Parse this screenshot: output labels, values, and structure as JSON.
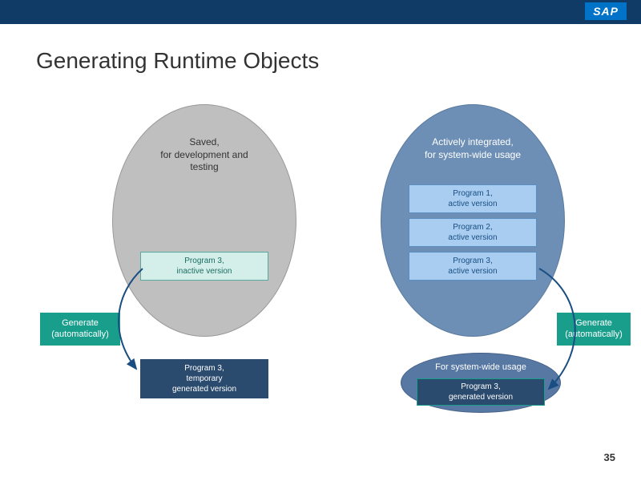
{
  "header": {
    "logo": "SAP"
  },
  "title": "Generating Runtime Objects",
  "left_ellipse": {
    "caption_line1": "Saved,",
    "caption_line2": "for development and",
    "caption_line3": "testing",
    "program3_inactive_l1": "Program 3,",
    "program3_inactive_l2": "inactive version"
  },
  "right_ellipse": {
    "caption_line1": "Actively integrated,",
    "caption_line2": "for system-wide usage",
    "p1_l1": "Program 1,",
    "p1_l2": "active version",
    "p2_l1": "Program 2,",
    "p2_l2": "active version",
    "p3_l1": "Program 3,",
    "p3_l2": "active version"
  },
  "small_ellipse": {
    "caption": "For system-wide usage",
    "gen_l1": "Program 3,",
    "gen_l2": "generated version"
  },
  "generate_left": {
    "l1": "Generate",
    "l2": "(automatically)"
  },
  "generate_right": {
    "l1": "Generate",
    "l2": "(automatically)"
  },
  "temp_box": {
    "l1": "Program 3,",
    "l2": "temporary",
    "l3": "generated version"
  },
  "page_number": "35"
}
